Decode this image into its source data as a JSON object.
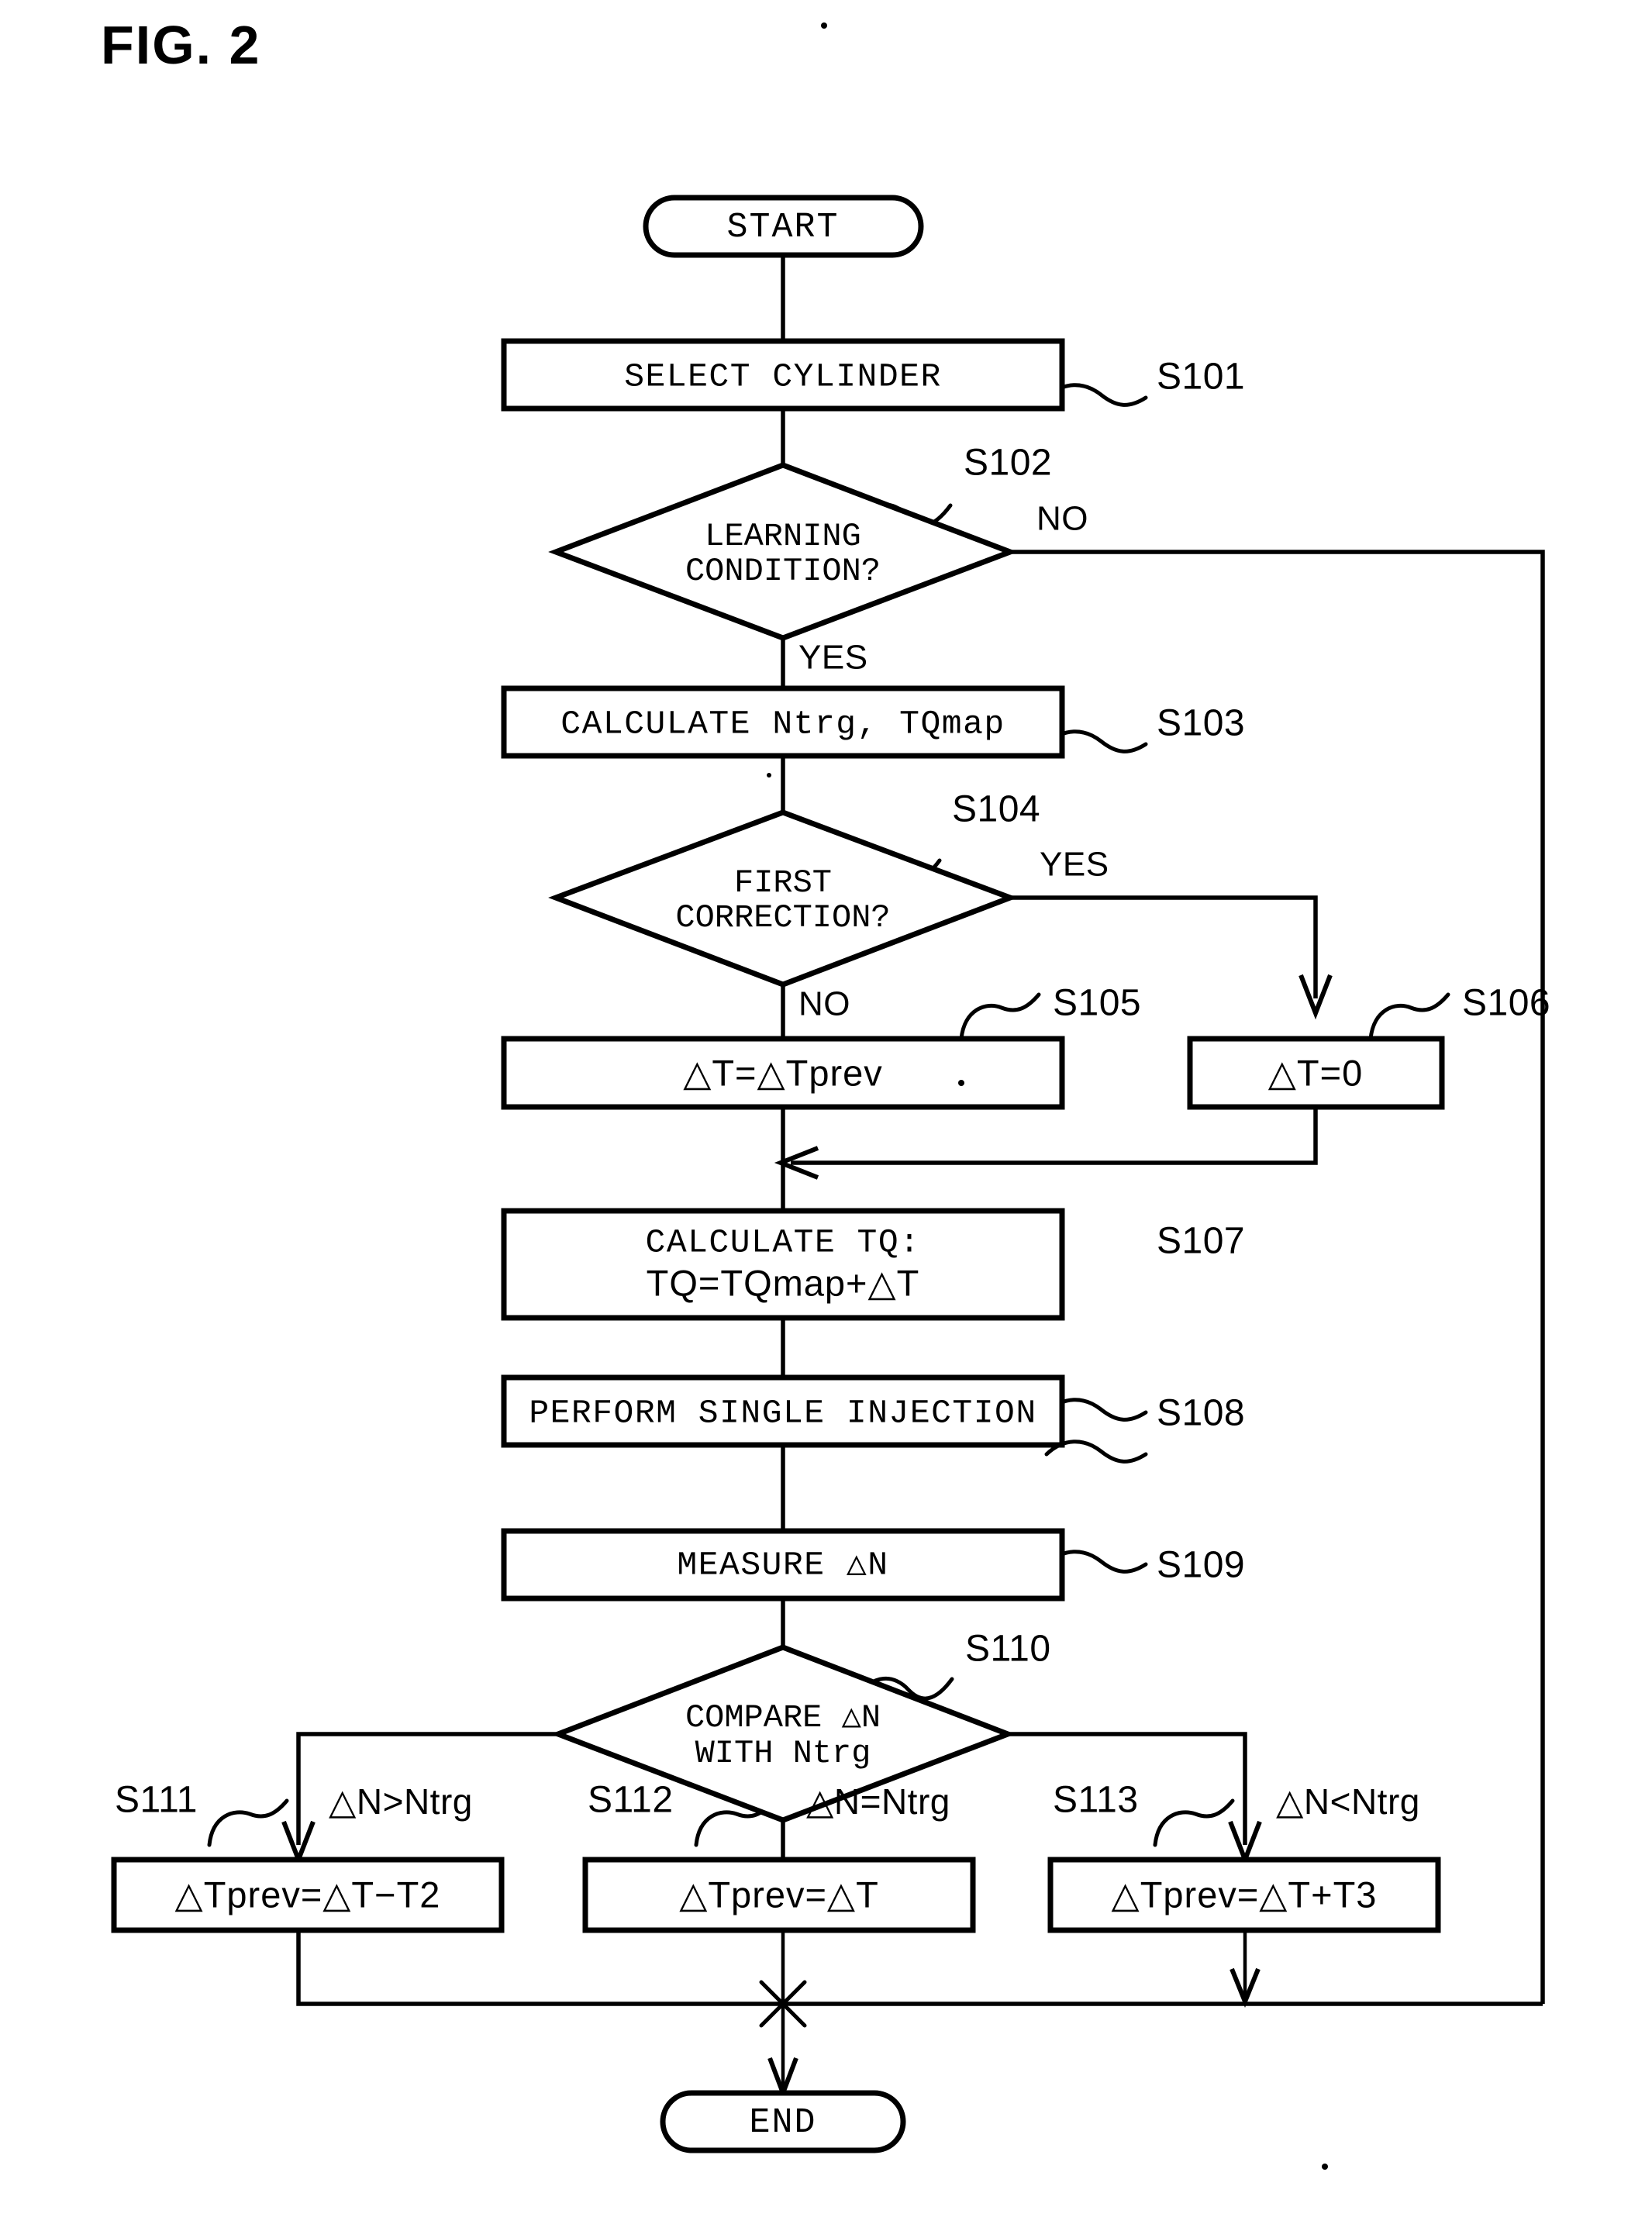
{
  "figure": {
    "title": "FIG. 2",
    "type": "patent-flowchart"
  },
  "nodes": {
    "start": {
      "label": "START",
      "shape": "terminator"
    },
    "end": {
      "label": "END",
      "shape": "terminator"
    },
    "s101": {
      "step": "S101",
      "label": "SELECT CYLINDER",
      "shape": "process"
    },
    "s102": {
      "step": "S102",
      "line1": "LEARNING",
      "line2": "CONDITION?",
      "shape": "decision"
    },
    "s103": {
      "step": "S103",
      "label": "CALCULATE Ntrg, TQmap",
      "shape": "process"
    },
    "s104": {
      "step": "S104",
      "line1": "FIRST",
      "line2": "CORRECTION?",
      "shape": "decision"
    },
    "s105": {
      "step": "S105",
      "label": "△T=△Tprev",
      "shape": "process"
    },
    "s106": {
      "step": "S106",
      "label": "△T=0",
      "shape": "process"
    },
    "s107": {
      "step": "S107",
      "line1": "CALCULATE TQ:",
      "line2": "TQ=TQmap+△T",
      "shape": "process"
    },
    "s108": {
      "step": "S108",
      "label": "PERFORM SINGLE INJECTION",
      "shape": "process"
    },
    "s109": {
      "step": "S109",
      "label": "MEASURE  △N",
      "shape": "process"
    },
    "s110": {
      "step": "S110",
      "line1": "COMPARE  △N",
      "line2": "WITH Ntrg",
      "shape": "decision"
    },
    "s111": {
      "step": "S111",
      "label": "△Tprev=△T−T2",
      "shape": "process"
    },
    "s112": {
      "step": "S112",
      "label": "△Tprev=△T",
      "shape": "process"
    },
    "s113": {
      "step": "S113",
      "label": "△Tprev=△T+T3",
      "shape": "process"
    }
  },
  "branch_labels": {
    "s102_no": "NO",
    "s102_yes": "YES",
    "s104_yes": "YES",
    "s104_no": "NO",
    "s110_greater": "△N>Ntrg",
    "s110_equal": "△N=Ntrg",
    "s110_less": "△N<Ntrg"
  },
  "colors": {
    "stroke": "#000000",
    "fill": "#ffffff",
    "background": "#ffffff"
  }
}
